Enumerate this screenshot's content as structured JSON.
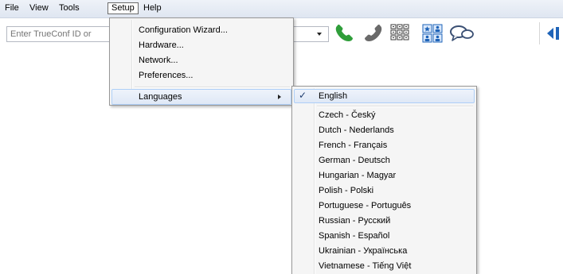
{
  "menubar": {
    "items": [
      {
        "label": "File"
      },
      {
        "label": "View"
      },
      {
        "label": "Tools"
      },
      {
        "label": "Setup"
      },
      {
        "label": "Help"
      }
    ]
  },
  "toolbar": {
    "id_input_placeholder": "Enter TrueConf ID or",
    "id_input_value": "",
    "icons": [
      "call-icon",
      "hangup-icon",
      "dialpad-icon",
      "contacts-grid-icon",
      "chat-icon",
      "panel-toggle-icon"
    ]
  },
  "setup_menu": {
    "items": [
      {
        "label": "Configuration Wizard..."
      },
      {
        "label": "Hardware..."
      },
      {
        "label": "Network..."
      },
      {
        "label": "Preferences..."
      }
    ],
    "languages_label": "Languages"
  },
  "languages_menu": {
    "selected": "English",
    "items": [
      {
        "label": "Czech - Český"
      },
      {
        "label": "Dutch - Nederlands"
      },
      {
        "label": "French - Français"
      },
      {
        "label": "German - Deutsch"
      },
      {
        "label": "Hungarian - Magyar"
      },
      {
        "label": "Polish - Polski"
      },
      {
        "label": "Portuguese - Português"
      },
      {
        "label": "Russian - Русский"
      },
      {
        "label": "Spanish - Español"
      },
      {
        "label": "Ukrainian - Українська"
      },
      {
        "label": "Vietnamese - Tiếng Việt"
      }
    ]
  },
  "colors": {
    "call_green": "#2f9e3a",
    "hangup_gray": "#6a6a6a",
    "accent_blue": "#1e63b8",
    "menu_highlight": "#aecff7"
  }
}
